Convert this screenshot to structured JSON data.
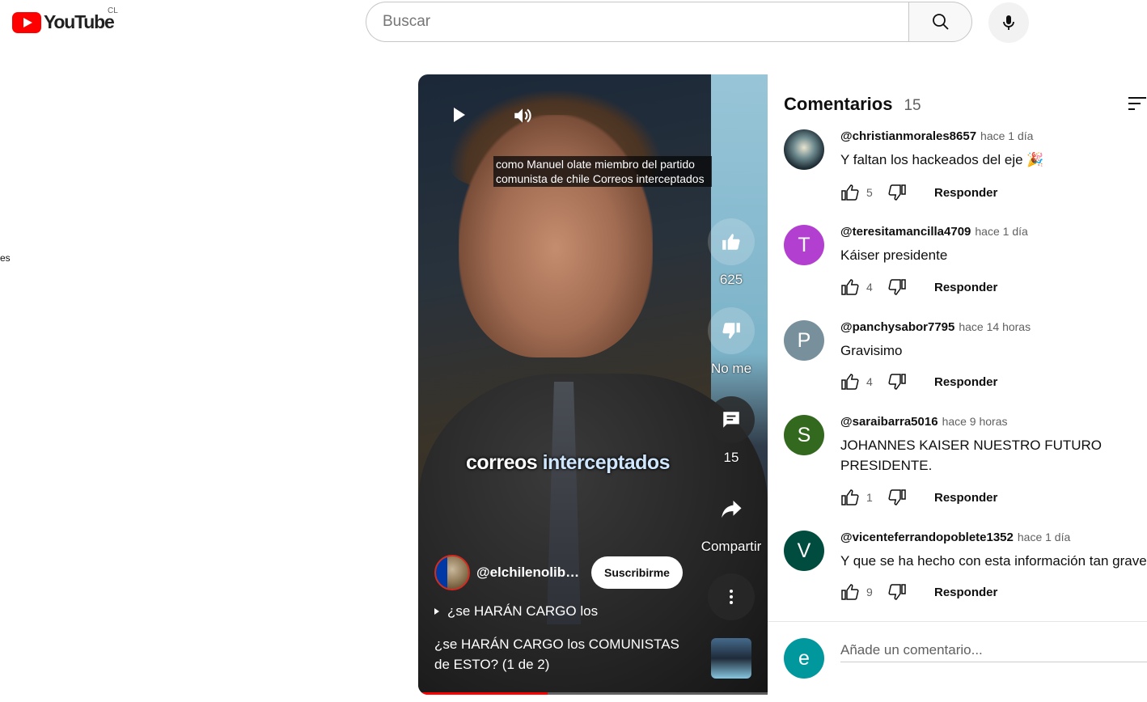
{
  "header": {
    "logo_text": "YouTube",
    "region": "CL",
    "search_placeholder": "Buscar",
    "icons": {
      "search": "search-icon",
      "mic": "mic-icon"
    }
  },
  "sidebar_fragment": "es",
  "video": {
    "caption": "como Manuel olate miembro del partido comunista de chile Correos interceptados",
    "burned_caption_white": "correos ",
    "burned_caption_accent": "interceptados",
    "likes": "625",
    "dislike_label": "No me",
    "comments_count": "15",
    "share_label": "Compartir",
    "channel_name": "@elchilenolibe…",
    "subscribe_label": "Suscribirme",
    "playlist_label": "¿se HARÁN CARGO los",
    "title": "¿se HARÁN CARGO los COMUNISTAS de ESTO? (1 de 2)",
    "progress_fraction": 0.37
  },
  "comments": {
    "title": "Comentarios",
    "count": "15",
    "items": [
      {
        "author": "@christianmorales8657",
        "time": "hace 1 día",
        "text": "Y faltan los hackeados del eje 🎉",
        "likes": "5",
        "avatar_letter": "",
        "avatar_color": "#2b3a4a"
      },
      {
        "author": "@teresitamancilla4709",
        "time": "hace 1 día",
        "text": "Káiser presidente",
        "likes": "4",
        "avatar_letter": "T",
        "avatar_color": "#b33fd1"
      },
      {
        "author": "@panchysabor7795",
        "time": "hace 14 horas",
        "text": "Gravisimo",
        "likes": "4",
        "avatar_letter": "P",
        "avatar_color": "#78909c"
      },
      {
        "author": "@saraibarra5016",
        "time": "hace 9 horas",
        "text": "JOHANNES KAISER NUESTRO FUTURO PRESIDENTE.",
        "likes": "1",
        "avatar_letter": "S",
        "avatar_color": "#33691e"
      },
      {
        "author": "@vicenteferrandopoblete1352",
        "time": "hace 1 día",
        "text": "Y que se ha hecho con esta información tan grave",
        "likes": "9",
        "avatar_letter": "V",
        "avatar_color": "#004d40"
      }
    ],
    "reply_label": "Responder",
    "add_placeholder": "Añade un comentario...",
    "self_avatar_letter": "e"
  }
}
